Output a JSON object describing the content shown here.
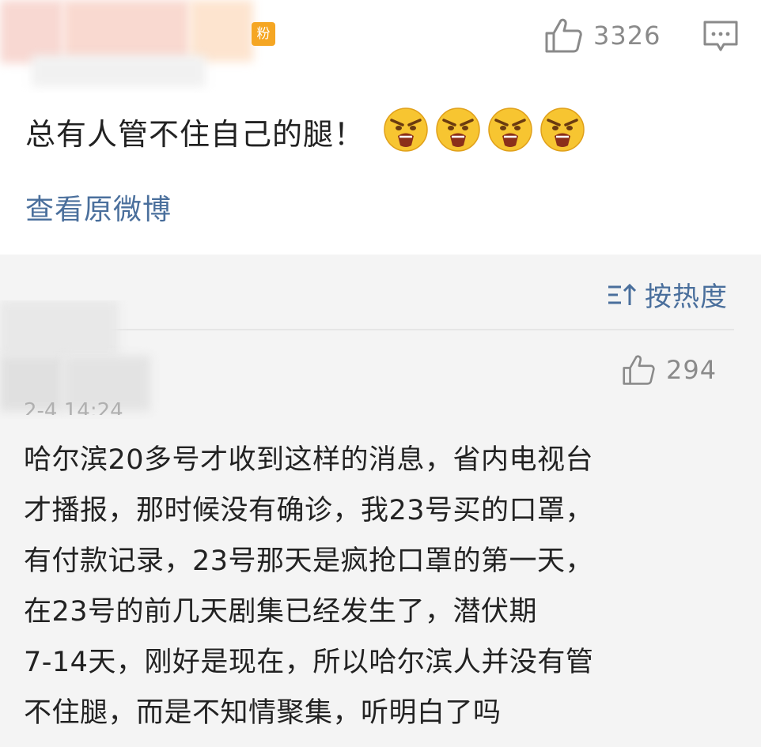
{
  "post": {
    "fan_badge": "粉",
    "like_count": "3326",
    "text": "总有人管不住自己的腿！",
    "emoji_icons": [
      "angry-face-icon",
      "angry-face-icon",
      "angry-face-icon",
      "angry-face-icon"
    ],
    "view_original": "查看原微博"
  },
  "comments_section": {
    "sort_label": "按热度",
    "comment": {
      "timestamp": "2-4 14:24",
      "like_count": "294",
      "lines": [
        "哈尔滨20多号才收到这样的消息，省内电视台",
        "才播报，那时候没有确诊，我23号买的口罩，",
        "有付款记录，23号那天是疯抢口罩的第一天，",
        "在23号的前几天剧集已经发生了，潜伏期",
        "7-14天，刚好是现在，所以哈尔滨人并没有管",
        "不住腿，而是不知情聚集，听明白了吗"
      ]
    }
  },
  "colors": {
    "link_blue": "#4a6f9c",
    "gray_count": "#8a8a8a",
    "badge_orange": "#f5a623",
    "comments_bg": "#f4f4f4"
  }
}
